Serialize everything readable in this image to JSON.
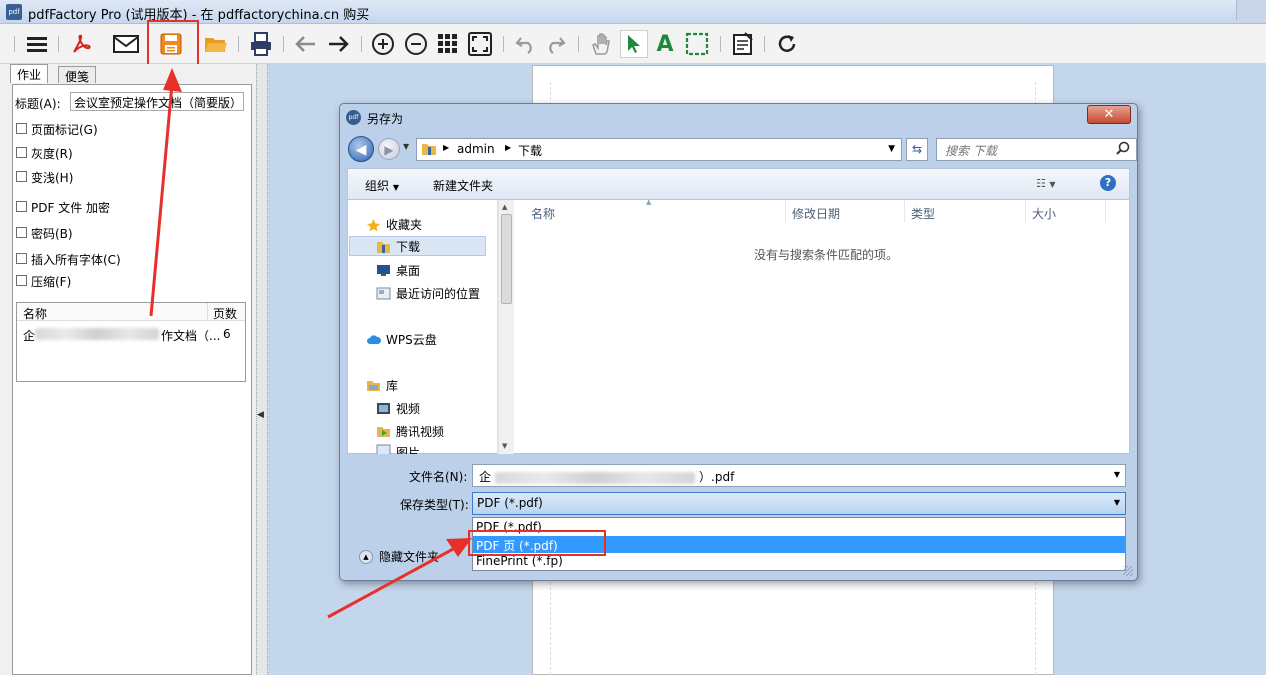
{
  "app": {
    "title": "pdfFactory Pro (试用版本) - 在 pdffactorychina.cn 购买",
    "icon_text": "pdf"
  },
  "toolbar": {
    "icons": [
      "menu-icon",
      "acrobat-icon",
      "email-icon",
      "save-icon",
      "open-folder-icon",
      "print-icon",
      "back-arrow-icon",
      "forward-arrow-icon",
      "zoom-in-icon",
      "zoom-out-icon",
      "grid-icon",
      "fit-page-icon",
      "undo-icon",
      "redo-icon",
      "hand-icon",
      "select-arrow-icon",
      "text-tool-icon",
      "crop-select-icon",
      "notes-icon",
      "refresh-icon"
    ],
    "highlight_color": "#e8302a"
  },
  "left_panel": {
    "tabs": [
      "作业",
      "便笺"
    ],
    "title_label": "标题(A):",
    "title_value": "会议室预定操作文档（简要版）",
    "options": [
      "页面标记(G)",
      "灰度(R)",
      "变浅(H)",
      "PDF 文件 加密",
      "密码(B)",
      "插入所有字体(C)",
      "压缩(F)"
    ],
    "table": {
      "columns": [
        "名称",
        "页数"
      ],
      "rows": [
        {
          "name_start": "企",
          "name_end": "作文档（...",
          "pages": "6"
        }
      ]
    }
  },
  "dialog": {
    "title": "另存为",
    "icon_text": "pdf",
    "close_label": "✕",
    "address": {
      "segments": [
        "admin",
        "下载"
      ]
    },
    "search_placeholder": "搜索 下载",
    "commands": {
      "organize": "组织",
      "new_folder": "新建文件夹",
      "help": "?"
    },
    "nav": {
      "favorites": "收藏夹",
      "downloads": "下载",
      "desktop": "桌面",
      "recent": "最近访问的位置",
      "wps": "WPS云盘",
      "library": "库",
      "videos": "视频",
      "tencent_video": "腾讯视频",
      "pictures": "图片"
    },
    "columns": [
      "名称",
      "修改日期",
      "类型",
      "大小"
    ],
    "empty_message": "没有与搜索条件匹配的项。",
    "filename_label": "文件名(N):",
    "filename_start": "企",
    "filename_end": "）.pdf",
    "filetype_label": "保存类型(T):",
    "filetype_value": "PDF (*.pdf)",
    "filetype_options": [
      "PDF (*.pdf)",
      "PDF 页 (*.pdf)",
      "FinePrint (*.fp)"
    ],
    "selected_option": "PDF 页 (*.pdf)",
    "hide_folders": "隐藏文件夹"
  }
}
